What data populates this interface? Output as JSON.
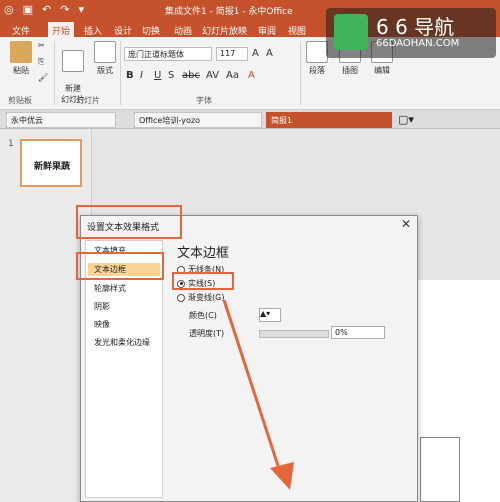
{
  "window": {
    "title": "集成文件1 - 简报1 - 永中Office"
  },
  "ribbon_tabs": [
    {
      "label": "文件"
    },
    {
      "label": "开始"
    },
    {
      "label": "插入"
    },
    {
      "label": "设计"
    },
    {
      "label": "切换"
    },
    {
      "label": "动画"
    },
    {
      "label": "幻灯片放映"
    },
    {
      "label": "审阅"
    },
    {
      "label": "视图"
    }
  ],
  "ribbon": {
    "paste": "粘贴",
    "clipboard_group": "剪贴板",
    "new_slide": "新建\n幻灯片",
    "layout": "版式",
    "slides_group": "幻灯片",
    "font_name": "庞门正道标题体",
    "font_size": "117",
    "font_group": "字体",
    "paragraph": "段落",
    "drawing": "插图",
    "editing": "编辑"
  },
  "doc_tabs": [
    {
      "label": "永中优云"
    },
    {
      "label": "Office培训-yozo"
    },
    {
      "label": "简报1"
    }
  ],
  "thumb": {
    "number": "1",
    "text": "新鲜果蔬"
  },
  "dialog": {
    "title": "设置文本效果格式",
    "nav": [
      {
        "label": "文本填充"
      },
      {
        "label": "文本边框"
      },
      {
        "label": "轮廓样式"
      },
      {
        "label": "阴影"
      },
      {
        "label": "映像"
      },
      {
        "label": "发光和柔化边缘"
      }
    ],
    "section_title": "文本边框",
    "options": [
      {
        "label": "无线条(N)",
        "selected": false
      },
      {
        "label": "实线(S)",
        "selected": true
      },
      {
        "label": "渐变线(G)",
        "selected": false
      }
    ],
    "color_label": "颜色(C)",
    "transparency_label": "透明度(T)",
    "transparency_value": "0%"
  },
  "watermark": {
    "main": "6 6 导航",
    "sub": "66DAOHAN.COM"
  },
  "colors": {
    "accent": "#c5522c",
    "highlight": "#e2683c",
    "selected_nav": "#f7d596"
  }
}
